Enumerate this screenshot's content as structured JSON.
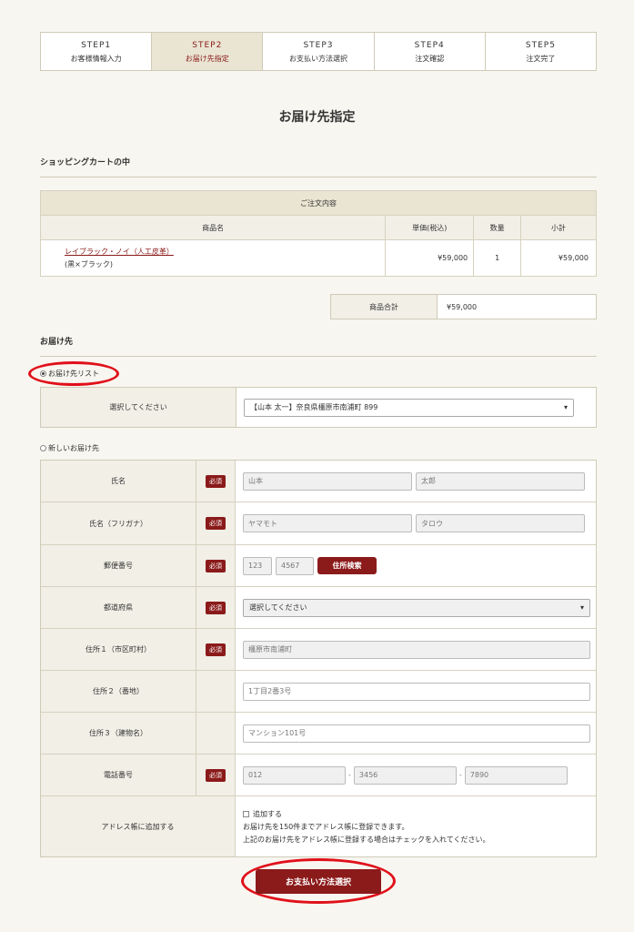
{
  "steps": [
    {
      "num": "STEP1",
      "label": "お客様情報入力"
    },
    {
      "num": "STEP2",
      "label": "お届け先指定"
    },
    {
      "num": "STEP3",
      "label": "お支払い方法選択"
    },
    {
      "num": "STEP4",
      "label": "注文確認"
    },
    {
      "num": "STEP5",
      "label": "注文完了"
    }
  ],
  "page_title": "お届け先指定",
  "cart": {
    "section_title": "ショッピングカートの中",
    "caption": "ご注文内容",
    "headers": [
      "商品名",
      "単価(税込)",
      "数量",
      "小計"
    ],
    "rows": [
      {
        "name": "レイブラック・ノイ（人工皮革）",
        "variant": "(黒×ブラック)",
        "price": "¥59,000",
        "qty": "1",
        "subtotal": "¥59,000"
      }
    ],
    "total_label": "商品合計",
    "total_value": "¥59,000"
  },
  "delivery": {
    "section_title": "お届け先",
    "list_option": "お届け先リスト",
    "list_select_label": "選択してください",
    "list_selected": "【山本 太一】奈良県橿原市南浦町 899",
    "new_option": "新しいお届け先",
    "required": "必須",
    "fields": {
      "name": {
        "label": "氏名",
        "last": "山本",
        "first": "太郎"
      },
      "kana": {
        "label": "氏名（フリガナ）",
        "last": "ヤマモト",
        "first": "タロウ"
      },
      "zip": {
        "label": "郵便番号",
        "part1": "123",
        "part2": "4567",
        "search_btn": "住所検索"
      },
      "pref": {
        "label": "都道府県",
        "value": "選択してください"
      },
      "addr1": {
        "label": "住所１（市区町村）",
        "value": "橿原市南浦町"
      },
      "addr2": {
        "label": "住所２（番地）",
        "value": "1丁目2番3号"
      },
      "addr3": {
        "label": "住所３（建物名）",
        "value": "マンション101号"
      },
      "tel": {
        "label": "電話番号",
        "part1": "012",
        "part2": "3456",
        "part3": "7890"
      },
      "book": {
        "label": "アドレス帳に追加する",
        "check_label": "追加する",
        "note1": "お届け先を150件までアドレス帳に登録できます。",
        "note2": "上記のお届け先をアドレス帳に登録する場合はチェックを入れてください。"
      }
    }
  },
  "submit_label": "お支払い方法選択",
  "icons": {
    "dropdown": "triangle-down-icon"
  },
  "colors": {
    "accent": "#8b1a1a",
    "highlight": "#e0101a",
    "header_bg": "#e9e5d2"
  }
}
